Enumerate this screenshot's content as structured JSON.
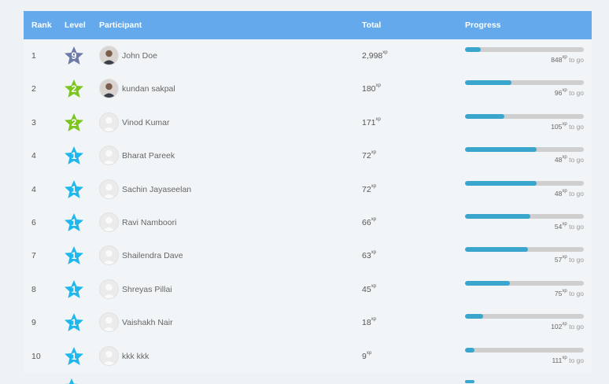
{
  "header": {
    "rank": "Rank",
    "level": "Level",
    "participant": "Participant",
    "total": "Total",
    "progress": "Progress"
  },
  "units": {
    "xp": "xp",
    "to_go": "to go"
  },
  "colors": {
    "header_bg": "#63a9eb",
    "bar_fill": "#3aa6cd",
    "bar_track": "#cfcfcf",
    "level_9": "#6e7aa8",
    "level_2": "#7cc520",
    "level_1": "#1fb7ec"
  },
  "rows": [
    {
      "rank": "1",
      "level": "9",
      "name": "John Doe",
      "avatar": "photo",
      "total": "2,998",
      "togo": "848",
      "progress": 0.13
    },
    {
      "rank": "2",
      "level": "2",
      "name": "kundan sakpal",
      "avatar": "photo",
      "total": "180",
      "togo": "96",
      "progress": 0.39
    },
    {
      "rank": "3",
      "level": "2",
      "name": "Vinod Kumar",
      "avatar": "placeholder",
      "total": "171",
      "togo": "105",
      "progress": 0.33
    },
    {
      "rank": "4",
      "level": "1",
      "name": "Bharat Pareek",
      "avatar": "placeholder",
      "total": "72",
      "togo": "48",
      "progress": 0.6
    },
    {
      "rank": "4",
      "level": "1",
      "name": "Sachin Jayaseelan",
      "avatar": "placeholder",
      "total": "72",
      "togo": "48",
      "progress": 0.6
    },
    {
      "rank": "6",
      "level": "1",
      "name": "Ravi Namboori",
      "avatar": "placeholder",
      "total": "66",
      "togo": "54",
      "progress": 0.55
    },
    {
      "rank": "7",
      "level": "1",
      "name": "Shailendra Dave",
      "avatar": "placeholder",
      "total": "63",
      "togo": "57",
      "progress": 0.53
    },
    {
      "rank": "8",
      "level": "1",
      "name": "Shreyas Pillai",
      "avatar": "placeholder",
      "total": "45",
      "togo": "75",
      "progress": 0.38
    },
    {
      "rank": "9",
      "level": "1",
      "name": "Vaishakh Nair",
      "avatar": "placeholder",
      "total": "18",
      "togo": "102",
      "progress": 0.15
    },
    {
      "rank": "10",
      "level": "1",
      "name": "kkk kkk",
      "avatar": "placeholder",
      "total": "9",
      "togo": "111",
      "progress": 0.08
    }
  ]
}
